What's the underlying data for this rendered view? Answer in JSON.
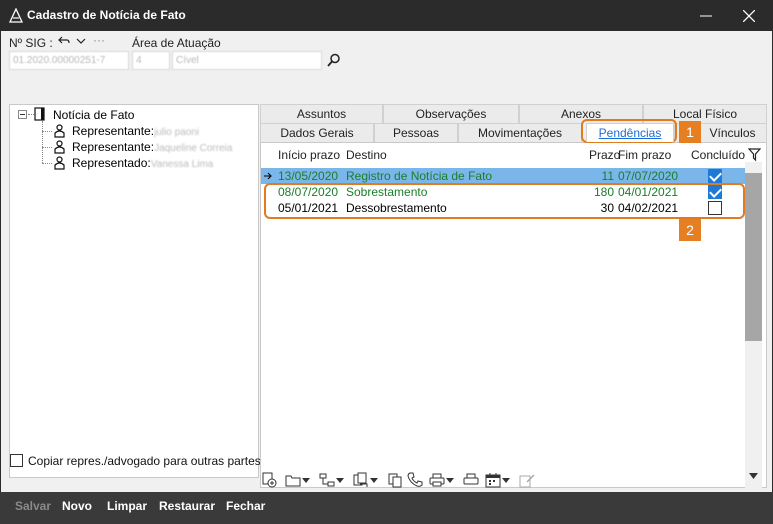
{
  "window": {
    "title": "Cadastro de Notícia de Fato"
  },
  "header": {
    "sig_label": "Nº SIG :",
    "sig_value": "01.2020.00000251-7",
    "area_label": "Área de Atuação",
    "area_code": "4",
    "area_value": "Cível"
  },
  "tree": {
    "root": "Notícia de Fato",
    "items": [
      {
        "label": "Representante:",
        "value": "julio paoni"
      },
      {
        "label": "Representante:",
        "value": "Jaqueline Correia"
      },
      {
        "label": "Representado:",
        "value": "Vanessa Lima"
      }
    ]
  },
  "copy_checkbox_label": "Copiar repres./advogado para outras partes",
  "tabs": {
    "row1": [
      "Assuntos",
      "Observações",
      "Anexos",
      "Local Físico"
    ],
    "row2": [
      "Dados Gerais",
      "Pessoas",
      "Movimentações",
      "Pendências",
      "Vínculos"
    ]
  },
  "grid": {
    "headers": [
      "Início prazo",
      "Destino",
      "Prazo",
      "Fim prazo",
      "Concluído"
    ],
    "rows": [
      {
        "inicio": "13/05/2020",
        "destino": "Registro de Notícia de Fato",
        "prazo": "11",
        "fim": "07/07/2020",
        "concluido": true
      },
      {
        "inicio": "08/07/2020",
        "destino": "Sobrestamento",
        "prazo": "180",
        "fim": "04/01/2021",
        "concluido": true
      },
      {
        "inicio": "05/01/2021",
        "destino": "Dessobrestamento",
        "prazo": "30",
        "fim": "04/02/2021",
        "concluido": false
      }
    ]
  },
  "callouts": {
    "one": "1",
    "two": "2"
  },
  "bottom": {
    "salvar": "Salvar",
    "novo": "Novo",
    "limpar": "Limpar",
    "restaurar": "Restaurar",
    "fechar": "Fechar"
  },
  "colors": {
    "accent": "#e67e22",
    "selected_row": "#7ab6ea",
    "green_text": "#1a7e2a"
  }
}
